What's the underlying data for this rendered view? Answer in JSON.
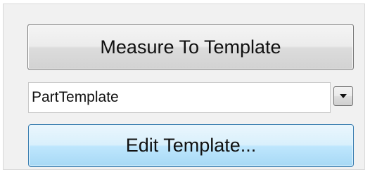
{
  "panel": {
    "measure_button_label": "Measure To Template",
    "template_select": {
      "selected_value": "PartTemplate"
    },
    "edit_button_label": "Edit Template..."
  },
  "icons": {
    "dropdown": "chevron-down-icon"
  },
  "colors": {
    "panel_bg": "#f1f1f1",
    "edit_button_border": "#3c7fb1",
    "edit_button_fill": "#bee6fd"
  }
}
